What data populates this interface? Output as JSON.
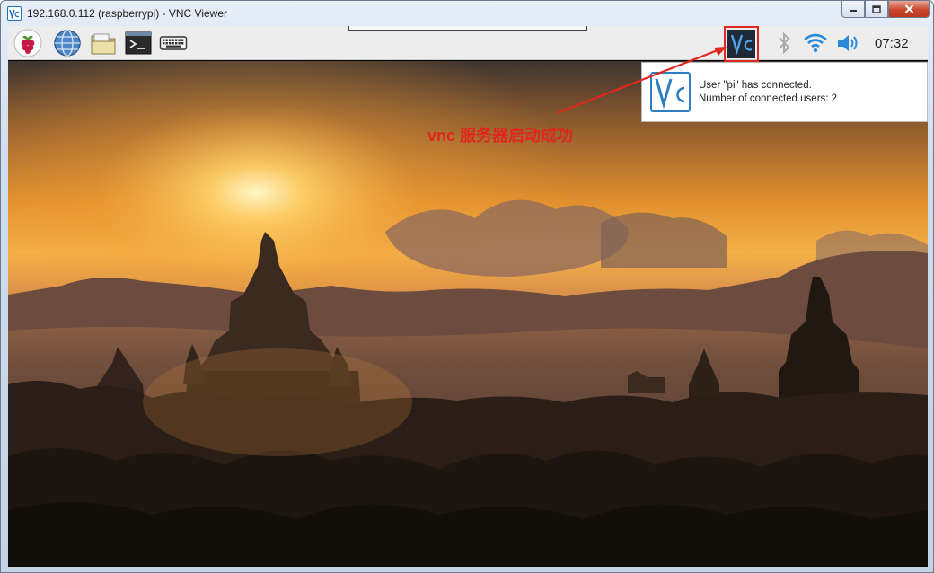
{
  "window": {
    "title": "192.168.0.112 (raspberrypi) - VNC Viewer",
    "app_icon": "vnc-icon"
  },
  "caption_buttons": {
    "minimize": "minimize-icon",
    "maximize": "maximize-icon",
    "close": "close-icon"
  },
  "taskbar": {
    "launchers": [
      {
        "icon": "raspberry-menu-icon"
      },
      {
        "icon": "web-browser-icon"
      },
      {
        "icon": "file-manager-icon"
      },
      {
        "icon": "terminal-icon"
      },
      {
        "icon": "keyboard-icon"
      }
    ],
    "tray": {
      "vnc_icon": "vnc-server-icon",
      "bluetooth_icon": "bluetooth-icon",
      "wifi_icon": "wifi-icon",
      "volume_icon": "volume-icon",
      "clock": "07:32"
    }
  },
  "notification": {
    "line1": "User \"pi\" has connected.",
    "line2": "Number of connected users: 2"
  },
  "annotation": {
    "text": "vnc 服务器启动成功",
    "color": "#e0261f"
  },
  "colors": {
    "accent": "#2e7dc2",
    "highlight": "#e0261f"
  }
}
